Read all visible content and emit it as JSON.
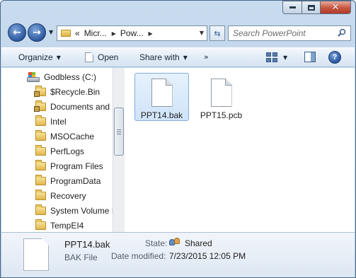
{
  "address_bar": {
    "overflow": "«",
    "segments": [
      "Micr...",
      "Pow..."
    ]
  },
  "search": {
    "placeholder": "Search PowerPoint"
  },
  "command_bar": {
    "organize": "Organize",
    "open": "Open",
    "share_with": "Share with",
    "more": "»"
  },
  "nav_tree": {
    "root": "Godbless (C:)",
    "items": [
      {
        "label": "$Recycle.Bin",
        "locked": true
      },
      {
        "label": "Documents and",
        "locked": true
      },
      {
        "label": "Intel",
        "locked": false
      },
      {
        "label": "MSOCache",
        "locked": false
      },
      {
        "label": "PerfLogs",
        "locked": false
      },
      {
        "label": "Program Files",
        "locked": false
      },
      {
        "label": "ProgramData",
        "locked": false
      },
      {
        "label": "Recovery",
        "locked": false
      },
      {
        "label": "System Volume I",
        "locked": false
      },
      {
        "label": "TempEI4",
        "locked": false
      }
    ]
  },
  "files": [
    {
      "name": "PPT14.bak",
      "selected": true
    },
    {
      "name": "PPT15.pcb",
      "selected": false
    }
  ],
  "details": {
    "file_name": "PPT14.bak",
    "file_type": "BAK File",
    "state_label": "State:",
    "state_value": "Shared",
    "modified_label": "Date modified:",
    "modified_value": "7/23/2015 12:05 PM"
  },
  "icons": {
    "back": "back-arrow-icon",
    "forward": "forward-arrow-icon",
    "refresh": "refresh-icon",
    "search": "search-icon",
    "help": "help-icon"
  }
}
